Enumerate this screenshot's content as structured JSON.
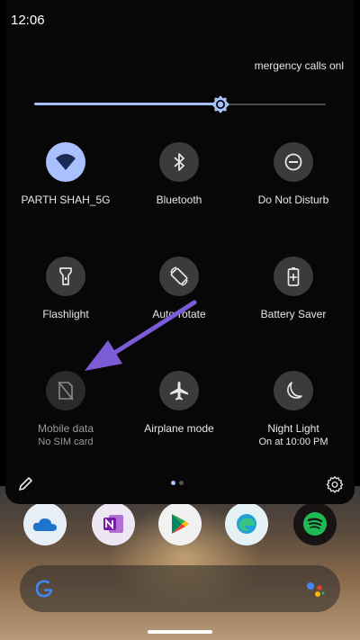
{
  "status_bar": {
    "time": "12:06"
  },
  "carrier_text": "mergency calls onl",
  "brightness": {
    "level": 0.63
  },
  "tiles": [
    {
      "label": "PARTH SHAH_5G",
      "sub": "",
      "icon": "wifi-icon",
      "state": "active"
    },
    {
      "label": "Bluetooth",
      "sub": "",
      "icon": "bluetooth-icon",
      "state": "off"
    },
    {
      "label": "Do Not Disturb",
      "sub": "",
      "icon": "dnd-icon",
      "state": "off"
    },
    {
      "label": "Flashlight",
      "sub": "",
      "icon": "flashlight-icon",
      "state": "off"
    },
    {
      "label": "Auto-rotate",
      "sub": "",
      "icon": "auto-rotate-icon",
      "state": "off"
    },
    {
      "label": "Battery Saver",
      "sub": "",
      "icon": "battery-saver-icon",
      "state": "off"
    },
    {
      "label": "Mobile data",
      "sub": "No SIM card",
      "icon": "no-sim-icon",
      "state": "disabled"
    },
    {
      "label": "Airplane mode",
      "sub": "",
      "icon": "airplane-icon",
      "state": "off"
    },
    {
      "label": "Night Light",
      "sub": "On at 10:00 PM",
      "icon": "night-light-icon",
      "state": "off"
    }
  ],
  "pages": {
    "current": 1,
    "total": 2
  },
  "colors": {
    "accent": "#a9c0ff",
    "panel": "#070707",
    "annotation_arrow": "#7b5cd6"
  },
  "dock": [
    "onedrive-icon",
    "onenote-icon",
    "play-store-icon",
    "edge-icon",
    "spotify-icon"
  ],
  "search": {
    "icons": [
      "google-icon",
      "assistant-icon"
    ]
  }
}
